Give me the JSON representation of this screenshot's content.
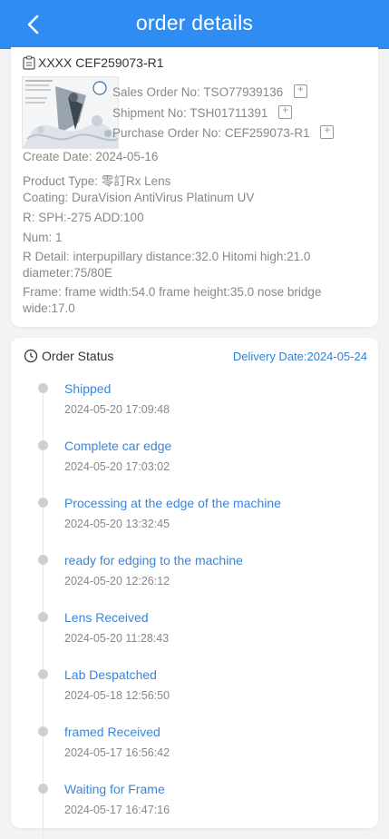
{
  "header": {
    "title": "order details"
  },
  "order": {
    "id_line": "XXXX CEF259073-R1",
    "sales_order": {
      "label": "Sales Order No:",
      "value": "TSO77939136"
    },
    "shipment": {
      "label": "Shipment No:",
      "value": "TSH01711391"
    },
    "purchase_order": {
      "label": "Purchase Order No:",
      "value": "CEF259073-R1"
    },
    "create_date": {
      "label": "Create Date:",
      "value": "2024-05-16"
    },
    "product_type": {
      "label": "Product Type:",
      "value": "零訂Rx Lens"
    },
    "coating": {
      "label": "Coating:",
      "value": "DuraVision AntiVirus Platinum UV"
    },
    "r": {
      "label": "R:",
      "value": "SPH:-275 ADD:100"
    },
    "num": {
      "label": "Num:",
      "value": "1"
    },
    "r_detail": {
      "label": "R Detail:",
      "value": "interpupillary distance:32.0 Hitomi high:21.0 diameter:75/80E"
    },
    "frame": {
      "label": "Frame:",
      "value": "frame width:54.0 frame height:35.0 nose bridge wide:17.0"
    }
  },
  "status": {
    "title": "Order Status",
    "delivery": "Delivery Date:2024-05-24",
    "events": [
      {
        "name": "Shipped",
        "time": "2024-05-20 17:09:48"
      },
      {
        "name": "Complete car edge",
        "time": "2024-05-20 17:03:02"
      },
      {
        "name": "Processing at the edge of the machine",
        "time": "2024-05-20 13:32:45"
      },
      {
        "name": "ready for edging to the machine",
        "time": "2024-05-20 12:26:12"
      },
      {
        "name": "Lens Received",
        "time": "2024-05-20 11:28:43"
      },
      {
        "name": "Lab Despatched",
        "time": "2024-05-18 12:56:50"
      },
      {
        "name": "framed Received",
        "time": "2024-05-17 16:56:42"
      },
      {
        "name": "Waiting for Frame",
        "time": "2024-05-17 16:47:16"
      }
    ]
  },
  "icons": {
    "back": "chevron-left-icon",
    "clipboard": "clipboard-icon",
    "clock": "clock-icon",
    "copy": "copy-icon"
  },
  "colors": {
    "header": "#2f8cf3",
    "link": "#3a86d8",
    "dot": "#cfcfcf"
  }
}
